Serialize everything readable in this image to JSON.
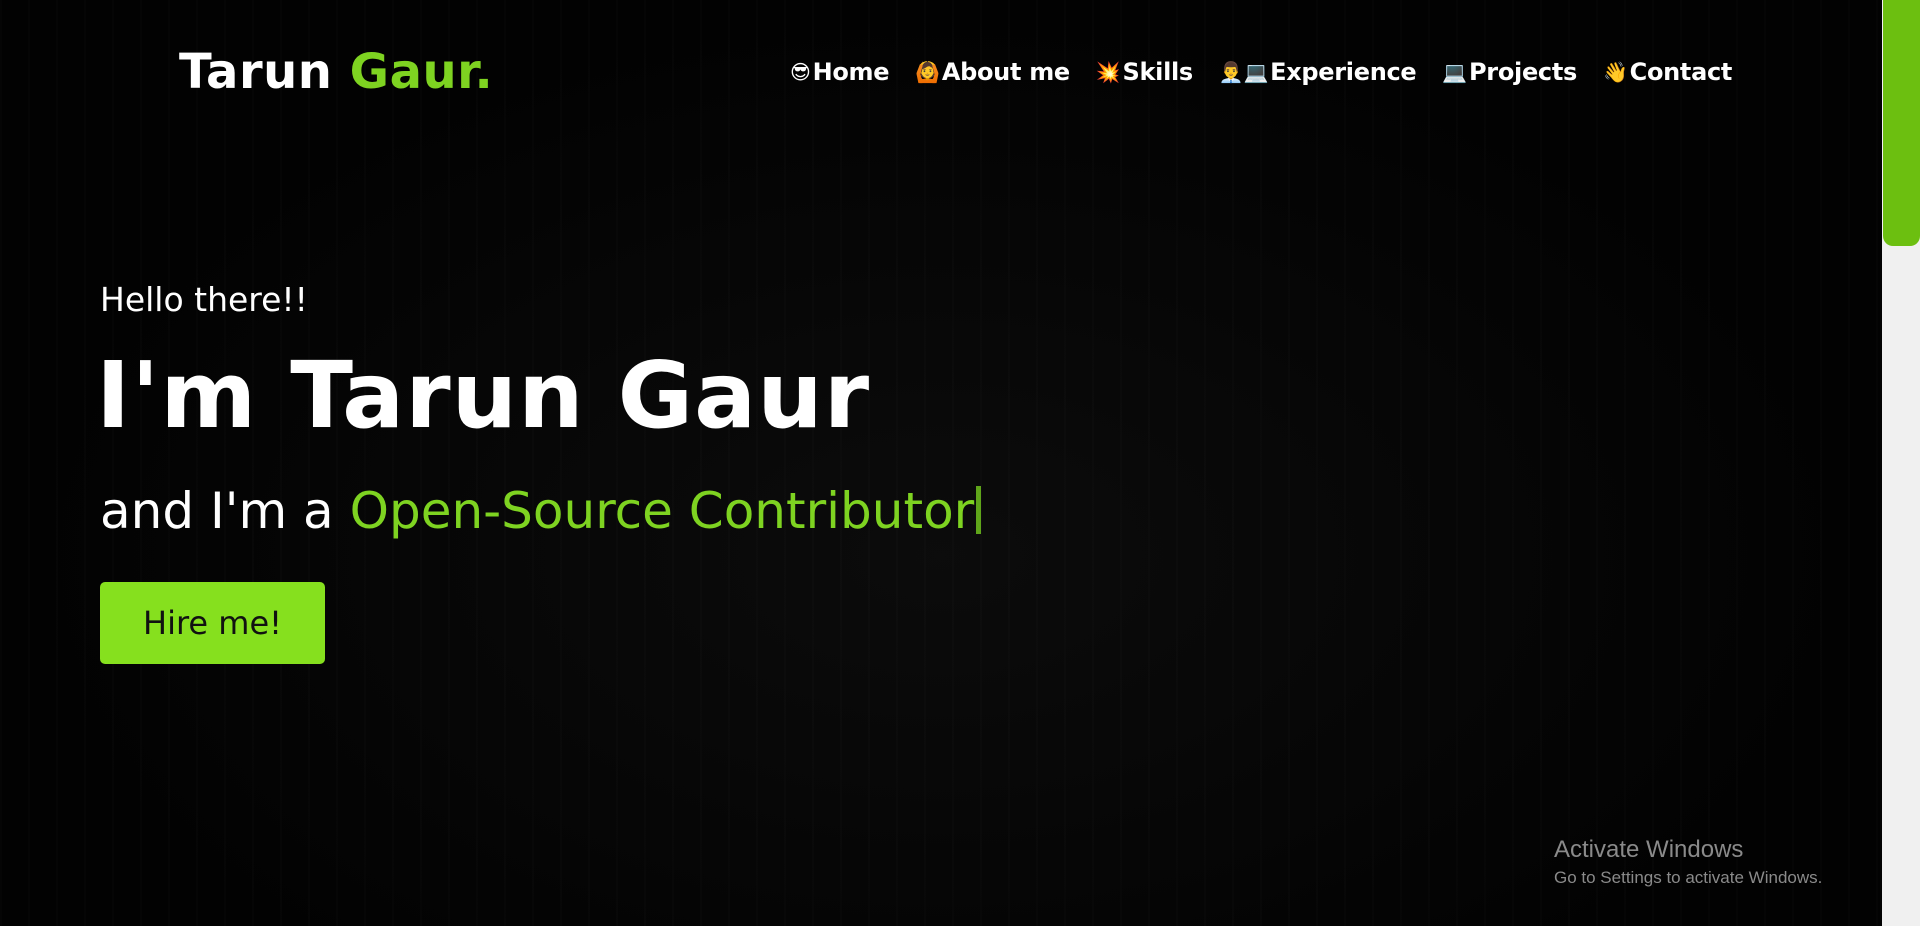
{
  "header": {
    "logo_main": "Tarun ",
    "logo_accent": "Gaur."
  },
  "nav": {
    "items": [
      {
        "icon": "😎",
        "label": "Home"
      },
      {
        "icon": "🙆",
        "label": "About me"
      },
      {
        "icon": "💥",
        "label": "Skills"
      },
      {
        "icon": "👨‍💼💻",
        "label": "Experience"
      },
      {
        "icon": "💻",
        "label": "Projects"
      },
      {
        "icon": "👋",
        "label": "Contact"
      }
    ]
  },
  "hero": {
    "greeting": "Hello there!!",
    "title": "I'm Tarun Gaur",
    "subtitle_prefix": "and I'm a ",
    "role": "Open-Source Contributor",
    "hire_button": "Hire me!"
  },
  "watermark": {
    "title": "Activate Windows",
    "subtitle": "Go to Settings to activate Windows."
  },
  "colors": {
    "background": "#000000",
    "accent": "#7ed321",
    "button": "#86e01e",
    "scrollbar_thumb": "#6cbf10"
  }
}
